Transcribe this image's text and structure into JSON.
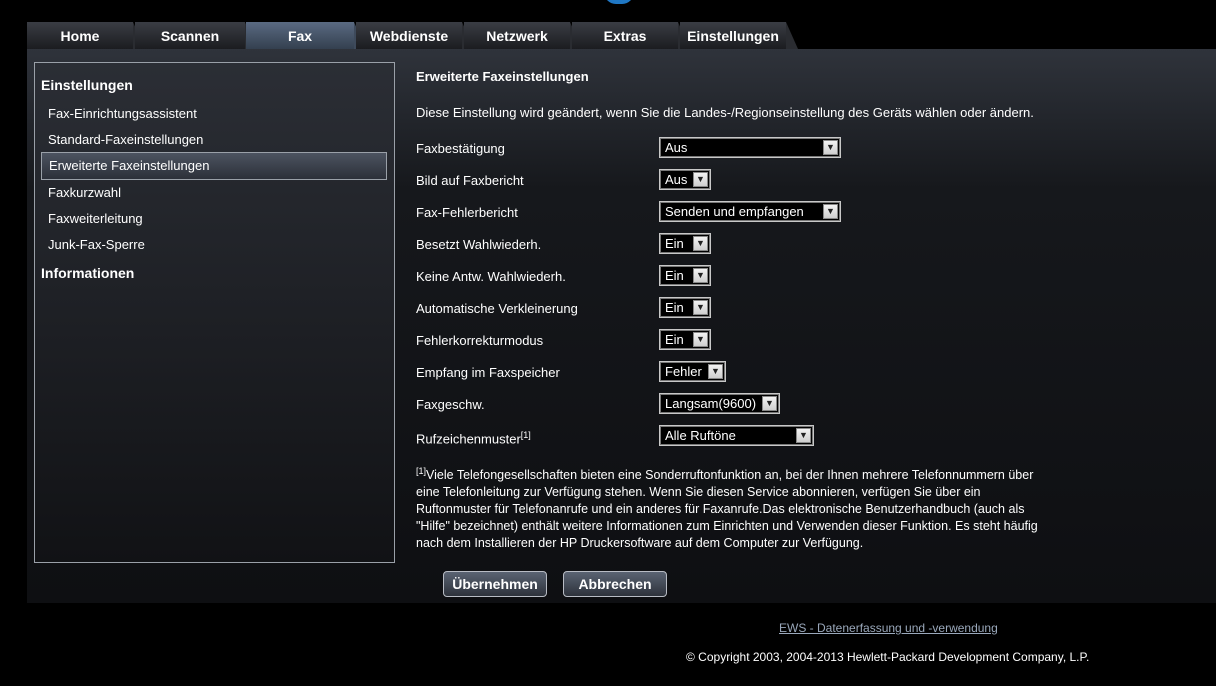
{
  "tabs": [
    "Home",
    "Scannen",
    "Fax",
    "Webdienste",
    "Netzwerk",
    "Extras",
    "Einstellungen"
  ],
  "active_tab": "Fax",
  "sidebar": {
    "heading_settings": "Einstellungen",
    "items": [
      "Fax-Einrichtungsassistent",
      "Standard-Faxeinstellungen",
      "Erweiterte Faxeinstellungen",
      "Faxkurzwahl",
      "Faxweiterleitung",
      "Junk-Fax-Sperre"
    ],
    "selected_item": "Erweiterte Faxeinstellungen",
    "heading_info": "Informationen"
  },
  "content": {
    "title": "Erweiterte Faxeinstellungen",
    "note": "Diese Einstellung wird geändert, wenn Sie die Landes-/Regionseinstellung des Geräts wählen oder ändern.",
    "rows": [
      {
        "label": "Faxbestätigung",
        "value": "Aus"
      },
      {
        "label": "Bild auf Faxbericht",
        "value": "Aus"
      },
      {
        "label": "Fax-Fehlerbericht",
        "value": "Senden und empfangen"
      },
      {
        "label": "Besetzt Wahlwiederh.",
        "value": "Ein"
      },
      {
        "label": "Keine Antw. Wahlwiederh.",
        "value": "Ein"
      },
      {
        "label": "Automatische Verkleinerung",
        "value": "Ein"
      },
      {
        "label": "Fehlerkorrekturmodus",
        "value": "Ein"
      },
      {
        "label": "Empfang im Faxspeicher",
        "value": "Fehler"
      },
      {
        "label": "Faxgeschw.",
        "value": "Langsam(9600)"
      },
      {
        "label": "Rufzeichenmuster",
        "sup": "[1]",
        "value": "Alle Ruftöne"
      }
    ],
    "footnote_marker": "[1]",
    "footnote_text": "Viele Telefongesellschaften bieten eine Sonderruftonfunktion an, bei der Ihnen mehrere Telefonnummern über eine Telefonleitung zur Verfügung stehen. Wenn Sie diesen Service abonnieren, verfügen Sie über ein Ruftonmuster für Telefonanrufe und ein anderes für Faxanrufe.Das elektronische Benutzerhandbuch (auch als \"Hilfe\" bezeichnet) enthält weitere Informationen zum Einrichten und Verwenden dieser Funktion. Es steht häufig nach dem Installieren der HP Druckersoftware auf dem Computer zur Verfügung."
  },
  "buttons": {
    "apply": "Übernehmen",
    "cancel": "Abbrechen"
  },
  "footer": {
    "link": "EWS - Datenerfassung und -verwendung",
    "copyright": "© Copyright 2003, 2004-2013 Hewlett-Packard Development Company, L.P."
  },
  "icons": {
    "dropdown": "chevron-down-icon",
    "logo": "hp-logo"
  }
}
